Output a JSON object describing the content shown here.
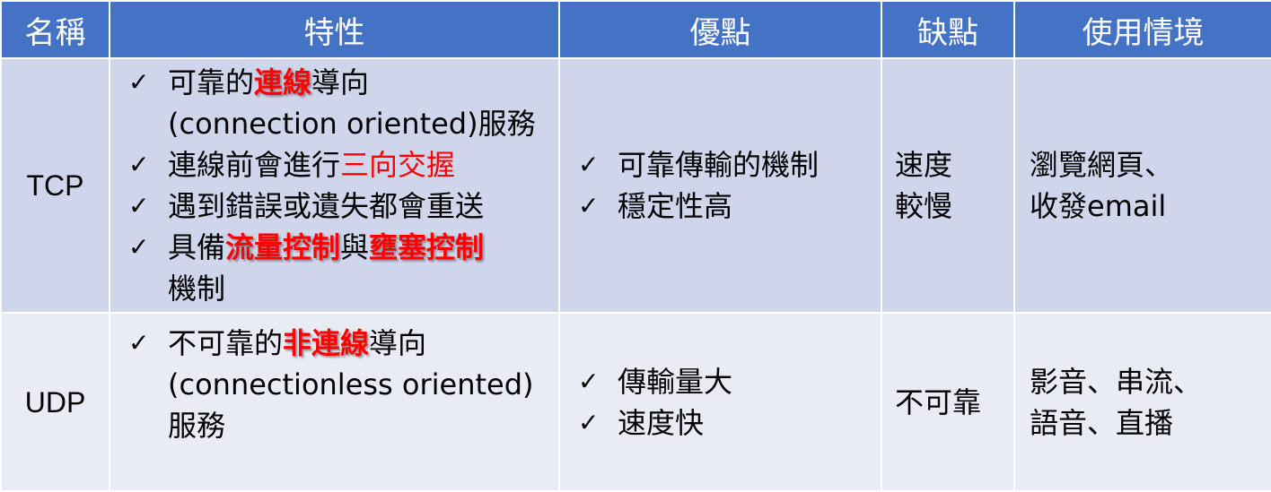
{
  "headers": [
    "名稱",
    "特性",
    "優點",
    "缺點",
    "使用情境"
  ],
  "colors": {
    "header_bg": "#4472c4",
    "row_a_bg": "#cfd5ea",
    "row_b_bg": "#e9ebf5",
    "highlight": "#ff0000"
  },
  "check_glyph": "✓",
  "rows": [
    {
      "name": "TCP",
      "features": [
        {
          "pre": "可靠的",
          "hl": "連線",
          "post": "導向",
          "line2": "(connection oriented)服務"
        },
        {
          "pre": "連線前會進行",
          "hl": "三向交握"
        },
        {
          "text": "遇到錯誤或遺失都會重送"
        },
        {
          "pre": "具備",
          "hl": "流量控制",
          "mid": "與",
          "hl2": "壅塞控制",
          "line2": "機制"
        }
      ],
      "pros": [
        "可靠傳輸的機制",
        "穩定性高"
      ],
      "cons": [
        "速度",
        "較慢"
      ],
      "use": [
        "瀏覽網頁、",
        "收發email"
      ]
    },
    {
      "name": "UDP",
      "features": [
        {
          "pre": "不可靠的",
          "hl": "非連線",
          "post": "導向",
          "line2": "(connectionless oriented)",
          "line3": "服務"
        }
      ],
      "pros": [
        "傳輸量大",
        "速度快"
      ],
      "cons": [
        "不可靠"
      ],
      "use": [
        "影音、串流、",
        "語音、直播"
      ]
    }
  ]
}
